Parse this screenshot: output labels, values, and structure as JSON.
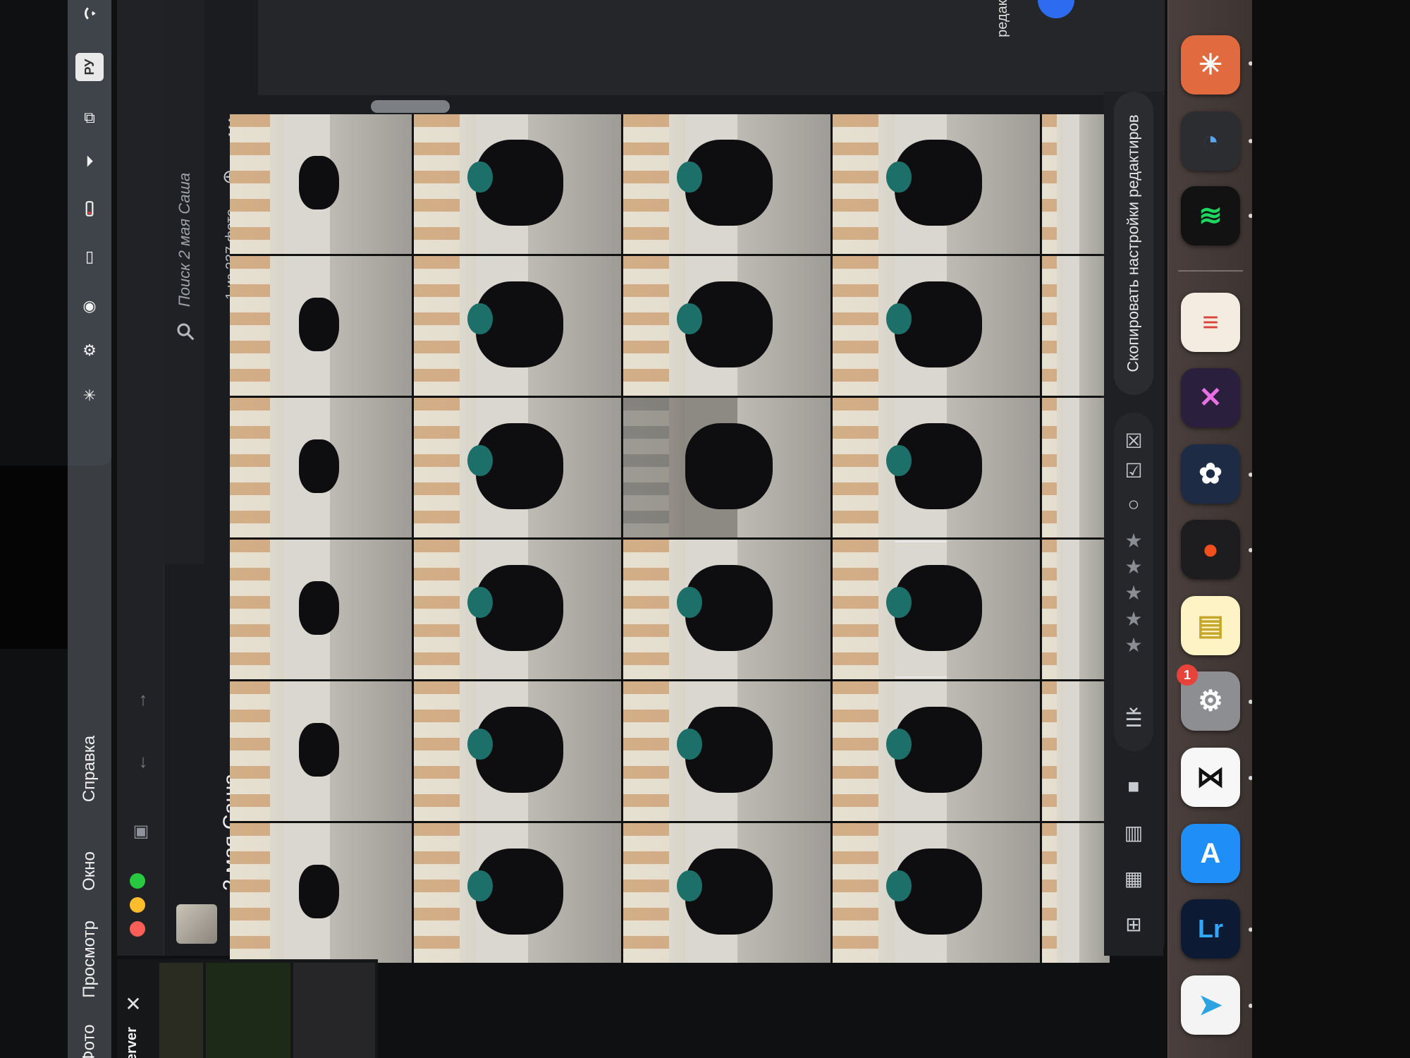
{
  "menubar": {
    "menus": [
      "Фото",
      "Просмотр",
      "Окно",
      "Справка"
    ],
    "input_source": "РУ",
    "status_icons": [
      "sparkle-icon",
      "control-center-icon",
      "location-icon",
      "battery-small-icon",
      "battery-icon",
      "play-icon",
      "copy-icon",
      "input-source-icon",
      "wifi-icon"
    ]
  },
  "album": {
    "title": "2 мая Саша",
    "search_placeholder": "Поиск 2 мая Саша",
    "count_text": "1 из 237 фото"
  },
  "top_panel": {
    "text": "редакт…"
  },
  "toolbar": {
    "copy_settings_label": "Скопировать настройки редактиров",
    "rating_stars": 5,
    "tools": [
      "grid-large-icon",
      "grid-small-icon",
      "compare-icon",
      "single-view-icon",
      "sort-icon",
      "chevron-down-icon",
      "flag-pick-icon",
      "flag-reject-icon",
      "circle-icon"
    ]
  },
  "dock": {
    "apps": [
      "Claude",
      "Transloader",
      "Spotify",
      "Books",
      "Affinity",
      "DaVinci Resolve",
      "Figma",
      "Notes",
      "System Settings",
      "CapCut",
      "App Store",
      "Lightroom",
      "Telegram"
    ],
    "settings_badge": "1",
    "lightroom_glyph": "Lr"
  },
  "sliver": {
    "title": "erver"
  },
  "colors": {
    "accent_blue": "#2d6bf0",
    "traffic_red": "#ff5f57",
    "traffic_yellow": "#febc2e",
    "traffic_green": "#28c840"
  }
}
